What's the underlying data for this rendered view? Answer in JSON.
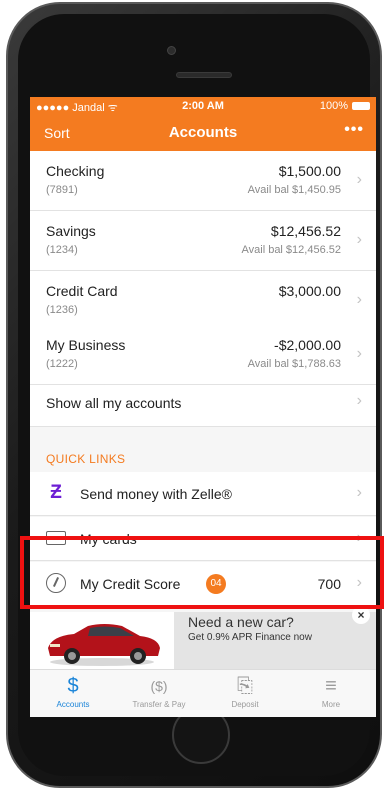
{
  "status_bar": {
    "carrier": "●●●●● Jandal ᯤ",
    "time": "2:00 AM",
    "battery": "100%"
  },
  "nav": {
    "left": "Sort",
    "title": "Accounts",
    "right": "•••"
  },
  "accounts": [
    {
      "name": "Checking",
      "number": "(7891)",
      "balance": "$1,500.00",
      "avail": "Avail bal $1,450.95"
    },
    {
      "name": "Savings",
      "number": "(1234)",
      "balance": "$12,456.52",
      "avail": "Avail bal $12,456.52"
    },
    {
      "name": "Credit Card",
      "number": "(1236)",
      "balance": "$3,000.00",
      "avail": ""
    },
    {
      "name": "My Business",
      "number": "(1222)",
      "balance": "-$2,000.00",
      "avail": "Avail bal $1,788.63"
    }
  ],
  "show_all": "Show all my accounts",
  "quick_links": {
    "title": "QUICK LINKS",
    "zelle": "Send money with Zelle®",
    "cards": "My cards",
    "credit_score": {
      "label": "My Credit Score",
      "badge": "04",
      "value": "700"
    }
  },
  "ad": {
    "headline": "Need a new car?",
    "subtext": "Get 0.9% APR Finance now",
    "close": "×"
  },
  "tabs": [
    {
      "label": "Accounts",
      "icon": "$"
    },
    {
      "label": "Transfer & Pay",
      "icon": "($)"
    },
    {
      "label": "Deposit",
      "icon": "⎘"
    },
    {
      "label": "More",
      "icon": "≡"
    }
  ],
  "chevron": "›",
  "colors": {
    "accent": "#f47b20",
    "active_tab": "#1a84d8",
    "zelle": "#6d1ed4",
    "highlight": "#ee1111"
  }
}
